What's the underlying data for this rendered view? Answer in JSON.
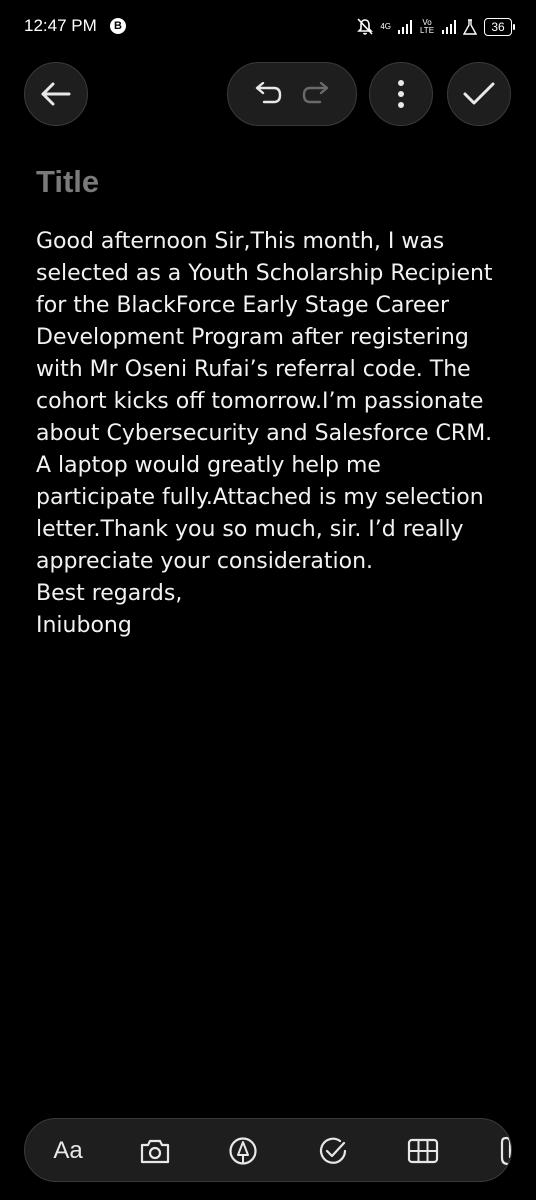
{
  "status_bar": {
    "time": "12:47 PM",
    "b_badge": "B",
    "network_label_1": "4G",
    "network_label_2": "Vo LTE",
    "battery": "36"
  },
  "toolbar": {
    "back_icon": "arrow-left-icon",
    "undo_icon": "undo-icon",
    "redo_icon": "redo-icon",
    "more_icon": "more-vertical-icon",
    "done_icon": "check-icon"
  },
  "note": {
    "title_placeholder": "Title",
    "body_lines": [
      "Good afternoon Sir,This month, I was",
      "selected as a Youth Scholarship Recipient",
      "for the BlackForce Early Stage Career",
      "Development Program after registering",
      "with Mr Oseni Rufai’s referral code. The",
      "cohort kicks off tomorrow.I’m passionate",
      "about Cybersecurity and Salesforce CRM.",
      "A laptop would greatly help me",
      "participate fully.Attached is my selection",
      "letter.Thank you so much, sir. I’d really",
      "appreciate your consideration.",
      "Best regards,",
      "Iniubong"
    ]
  },
  "bottom_toolbar": {
    "text_format_label": "Aa",
    "icons": [
      "camera-icon",
      "pen-icon",
      "checklist-icon",
      "table-icon",
      "attach-icon"
    ]
  }
}
